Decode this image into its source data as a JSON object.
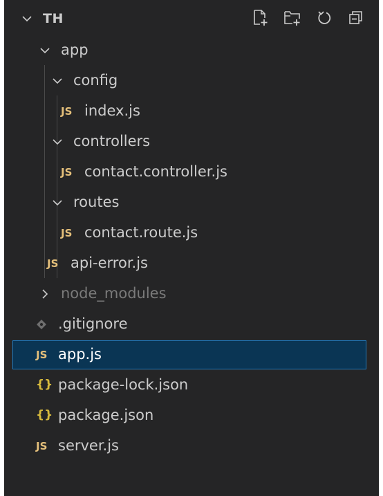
{
  "explorer": {
    "section_title": "TH",
    "actions": [
      {
        "name": "new-file-icon"
      },
      {
        "name": "new-folder-icon"
      },
      {
        "name": "refresh-icon"
      },
      {
        "name": "collapse-all-icon"
      }
    ]
  },
  "tree": [
    {
      "label": "app",
      "type": "folder",
      "expanded": true
    },
    {
      "label": "config",
      "type": "folder",
      "expanded": true
    },
    {
      "label": "index.js",
      "type": "file",
      "icon": "JS"
    },
    {
      "label": "controllers",
      "type": "folder",
      "expanded": true
    },
    {
      "label": "contact.controller.js",
      "type": "file",
      "icon": "JS"
    },
    {
      "label": "routes",
      "type": "folder",
      "expanded": true
    },
    {
      "label": "contact.route.js",
      "type": "file",
      "icon": "JS"
    },
    {
      "label": "api-error.js",
      "type": "file",
      "icon": "JS"
    },
    {
      "label": "node_modules",
      "type": "folder",
      "expanded": false
    },
    {
      "label": ".gitignore",
      "type": "file",
      "icon": ""
    },
    {
      "label": "app.js",
      "type": "file",
      "icon": "JS",
      "selected": true
    },
    {
      "label": "package-lock.json",
      "type": "file",
      "icon": "{}"
    },
    {
      "label": "package.json",
      "type": "file",
      "icon": "{}"
    },
    {
      "label": "server.js",
      "type": "file",
      "icon": "JS"
    }
  ],
  "colors": {
    "background": "#252526",
    "selection": "#0a3554",
    "js_icon": "#e5c07b",
    "json_icon": "#d7ba3d"
  }
}
